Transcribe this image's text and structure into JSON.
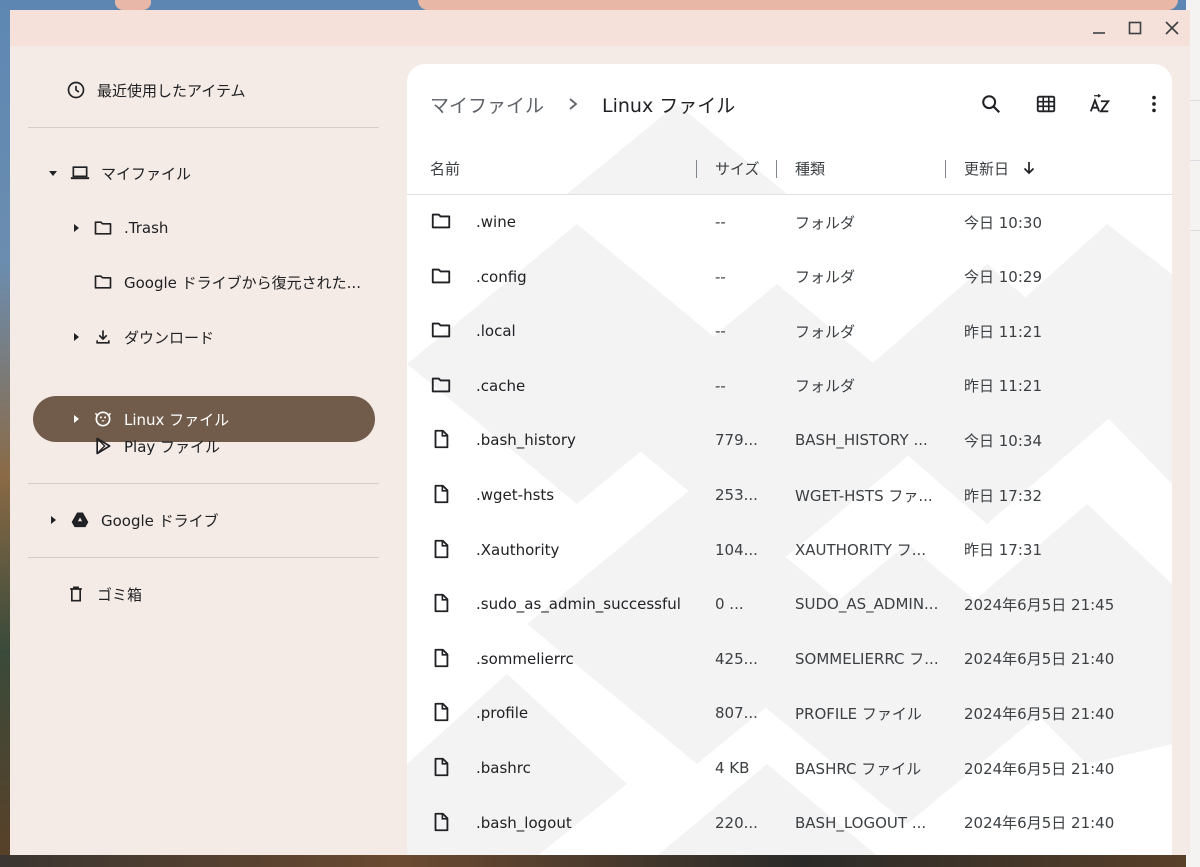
{
  "colors": {
    "window_bg": "#f4eae6",
    "titlebar_bg": "#f5e1d9",
    "selected_bg": "#715c4b",
    "main_bg": "#ffffff"
  },
  "window_controls": {
    "minimize_icon": "minimize-icon",
    "maximize_icon": "maximize-icon",
    "close_icon": "close-icon"
  },
  "sidebar": {
    "recent": {
      "label": "最近使用したアイテム",
      "icon": "clock-icon"
    },
    "my_files": {
      "label": "マイファイル",
      "icon": "laptop-icon",
      "expanded": true,
      "children": [
        {
          "label": ".Trash",
          "icon": "folder-icon",
          "has_children": true
        },
        {
          "label": "Google ドライブから復元された...",
          "icon": "folder-icon",
          "has_children": false
        },
        {
          "label": "ダウンロード",
          "icon": "download-icon",
          "has_children": true
        },
        {
          "label": "Linux ファイル",
          "icon": "penguin-icon",
          "has_children": true,
          "selected": true
        },
        {
          "label": "Play ファイル",
          "icon": "play-icon",
          "has_children": false
        }
      ]
    },
    "google_drive": {
      "label": "Google ドライブ",
      "icon": "drive-icon",
      "expanded": false
    },
    "trash": {
      "label": "ゴミ箱",
      "icon": "trash-icon"
    }
  },
  "breadcrumb": {
    "parent": "マイファイル",
    "current": "Linux ファイル"
  },
  "toolbar": {
    "search_icon": "search-icon",
    "grid_icon": "grid-view-icon",
    "sort_icon": "sort-az-icon",
    "more_icon": "more-vert-icon"
  },
  "table": {
    "columns": {
      "name": "名前",
      "size": "サイズ",
      "type": "種類",
      "modified": "更新日"
    },
    "sort_direction": "descending",
    "rows": [
      {
        "kind": "folder",
        "name": ".wine",
        "size": "--",
        "type": "フォルダ",
        "modified": "今日 10:30"
      },
      {
        "kind": "folder",
        "name": ".config",
        "size": "--",
        "type": "フォルダ",
        "modified": "今日 10:29"
      },
      {
        "kind": "folder",
        "name": ".local",
        "size": "--",
        "type": "フォルダ",
        "modified": "昨日 11:21"
      },
      {
        "kind": "folder",
        "name": ".cache",
        "size": "--",
        "type": "フォルダ",
        "modified": "昨日 11:21"
      },
      {
        "kind": "file",
        "name": ".bash_history",
        "size": "779...",
        "type": "BASH_HISTORY ...",
        "modified": "今日 10:34"
      },
      {
        "kind": "file",
        "name": ".wget-hsts",
        "size": "253...",
        "type": "WGET-HSTS ファ...",
        "modified": "昨日 17:32"
      },
      {
        "kind": "file",
        "name": ".Xauthority",
        "size": "104...",
        "type": "XAUTHORITY フ...",
        "modified": "昨日 17:31"
      },
      {
        "kind": "file",
        "name": ".sudo_as_admin_successful",
        "size": "0 ...",
        "type": "SUDO_AS_ADMIN...",
        "modified": "2024年6月5日 21:45"
      },
      {
        "kind": "file",
        "name": ".sommelierrc",
        "size": "425...",
        "type": "SOMMELIERRC フ...",
        "modified": "2024年6月5日 21:40"
      },
      {
        "kind": "file",
        "name": ".profile",
        "size": "807...",
        "type": "PROFILE ファイル",
        "modified": "2024年6月5日 21:40"
      },
      {
        "kind": "file",
        "name": ".bashrc",
        "size": "4 KB",
        "type": "BASHRC ファイル",
        "modified": "2024年6月5日 21:40"
      },
      {
        "kind": "file",
        "name": ".bash_logout",
        "size": "220...",
        "type": "BASH_LOGOUT ...",
        "modified": "2024年6月5日 21:40"
      }
    ]
  }
}
